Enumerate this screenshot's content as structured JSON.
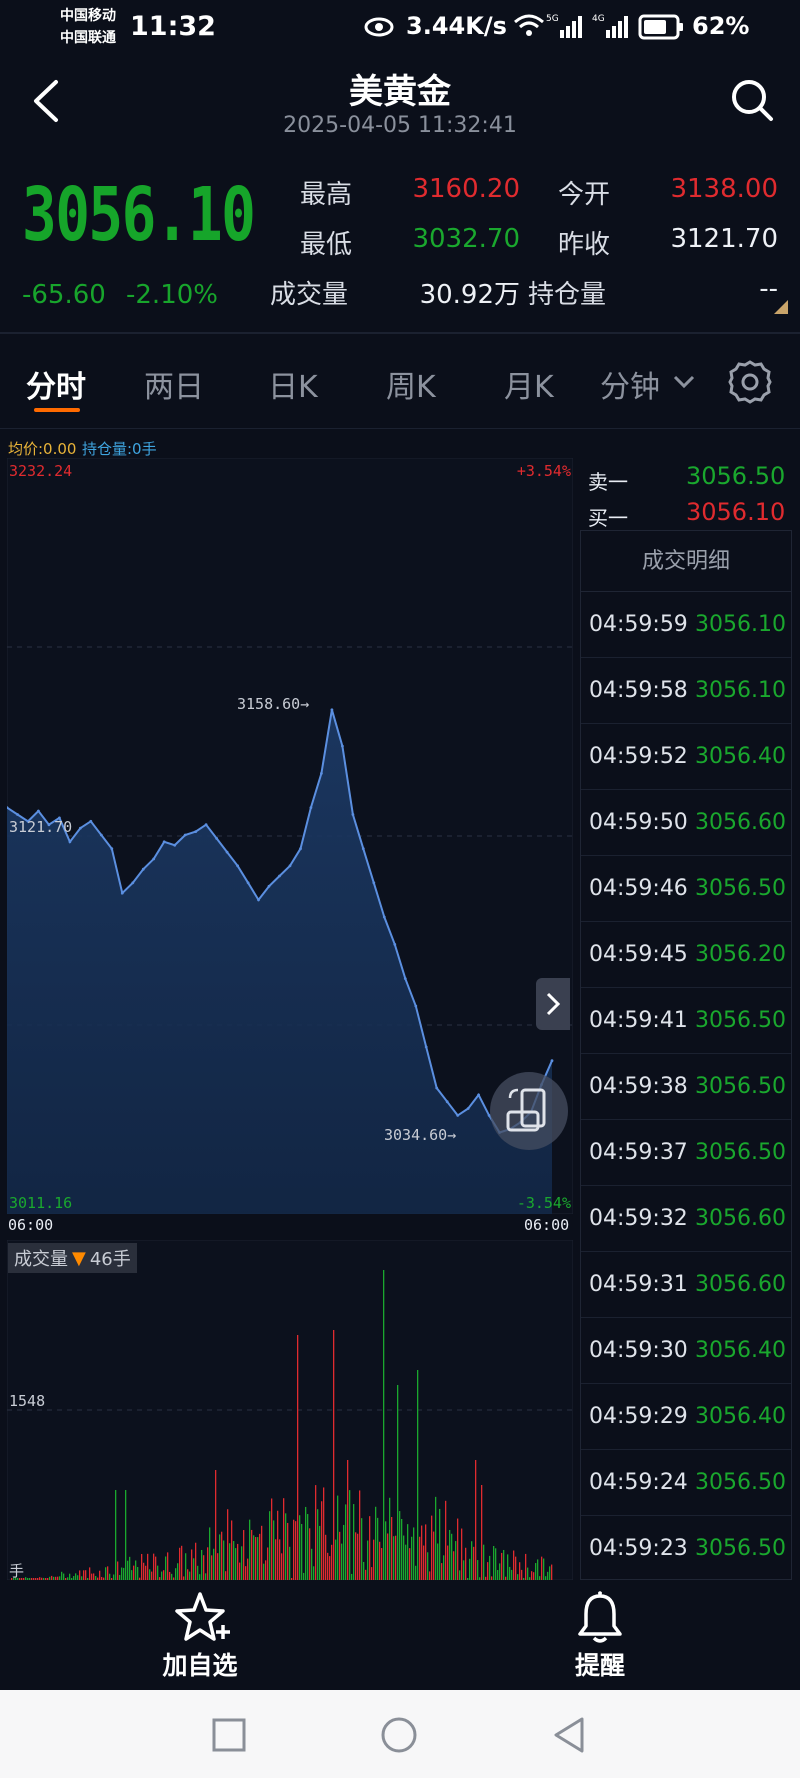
{
  "status_bar": {
    "carrier1": "中国移动",
    "carrier2": "中国联通",
    "time": "11:32",
    "speed": "3.44K/s",
    "battery": "62%"
  },
  "header": {
    "title": "美黄金",
    "datetime": "2025-04-05 11:32:41"
  },
  "quote": {
    "price": "3056.10",
    "change": "-65.60",
    "change_pct": "-2.10%",
    "high_label": "最高",
    "high": "3160.20",
    "open_label": "今开",
    "open": "3138.00",
    "low_label": "最低",
    "low": "3032.70",
    "prev_close_label": "昨收",
    "prev_close": "3121.70",
    "volume_label": "成交量",
    "volume": "30.92万",
    "oi_label": "持仓量",
    "oi": "--"
  },
  "tabs": [
    "分时",
    "两日",
    "日K",
    "周K",
    "月K",
    "分钟"
  ],
  "chart": {
    "avg_label": "均价:0.00",
    "oi_label": "持仓量:0手",
    "y_top": "3232.24",
    "y_top_pct": "+3.54%",
    "y_mid": "3121.70",
    "y_bottom": "3011.16",
    "y_bottom_pct": "-3.54%",
    "x_left": "06:00",
    "x_right": "06:00",
    "high_marker": "3158.60→",
    "low_marker": "3034.60→",
    "volume_label": "成交量",
    "volume_value": "46手",
    "volume_axis": "1548",
    "volume_unit": "手"
  },
  "chart_data": {
    "type": "line",
    "title": "",
    "ylim": [
      3011.16,
      3232.24
    ],
    "x": [
      "06:00",
      "06:00"
    ],
    "series": [
      {
        "values": [
          3130,
          3128,
          3126,
          3129,
          3125,
          3127,
          3120,
          3124,
          3126,
          3122,
          3118,
          3105,
          3108,
          3112,
          3115,
          3120,
          3119,
          3122,
          3123,
          3125,
          3121,
          3117,
          3113,
          3108,
          3103,
          3107,
          3110,
          3113,
          3118,
          3130,
          3140,
          3158.6,
          3148,
          3128,
          3118,
          3108,
          3098,
          3090,
          3080,
          3072,
          3060,
          3048,
          3044,
          3040,
          3042,
          3046,
          3040,
          3035,
          3036,
          3038,
          3041,
          3049,
          3056
        ]
      }
    ],
    "annotations": [
      "3158.60→",
      "3034.60→"
    ]
  },
  "orderbook": {
    "sell_label": "卖一",
    "sell": "3056.50",
    "buy_label": "买一",
    "buy": "3056.10"
  },
  "trades": {
    "header": "成交明细",
    "rows": [
      {
        "time": "04:59:59",
        "price": "3056.10"
      },
      {
        "time": "04:59:58",
        "price": "3056.10"
      },
      {
        "time": "04:59:52",
        "price": "3056.40"
      },
      {
        "time": "04:59:50",
        "price": "3056.60"
      },
      {
        "time": "04:59:46",
        "price": "3056.50"
      },
      {
        "time": "04:59:45",
        "price": "3056.20"
      },
      {
        "time": "04:59:41",
        "price": "3056.50"
      },
      {
        "time": "04:59:38",
        "price": "3056.50"
      },
      {
        "time": "04:59:37",
        "price": "3056.50"
      },
      {
        "time": "04:59:32",
        "price": "3056.60"
      },
      {
        "time": "04:59:31",
        "price": "3056.60"
      },
      {
        "time": "04:59:30",
        "price": "3056.40"
      },
      {
        "time": "04:59:29",
        "price": "3056.40"
      },
      {
        "time": "04:59:24",
        "price": "3056.50"
      },
      {
        "time": "04:59:23",
        "price": "3056.50"
      }
    ]
  },
  "bottom_bar": {
    "watchlist": "加自选",
    "alert": "提醒"
  },
  "colors": {
    "background": "#0b0f1a",
    "up": "#e02b2f",
    "down": "#1aa82e",
    "line": "#5b8fe0",
    "accent": "#ff6a00"
  }
}
